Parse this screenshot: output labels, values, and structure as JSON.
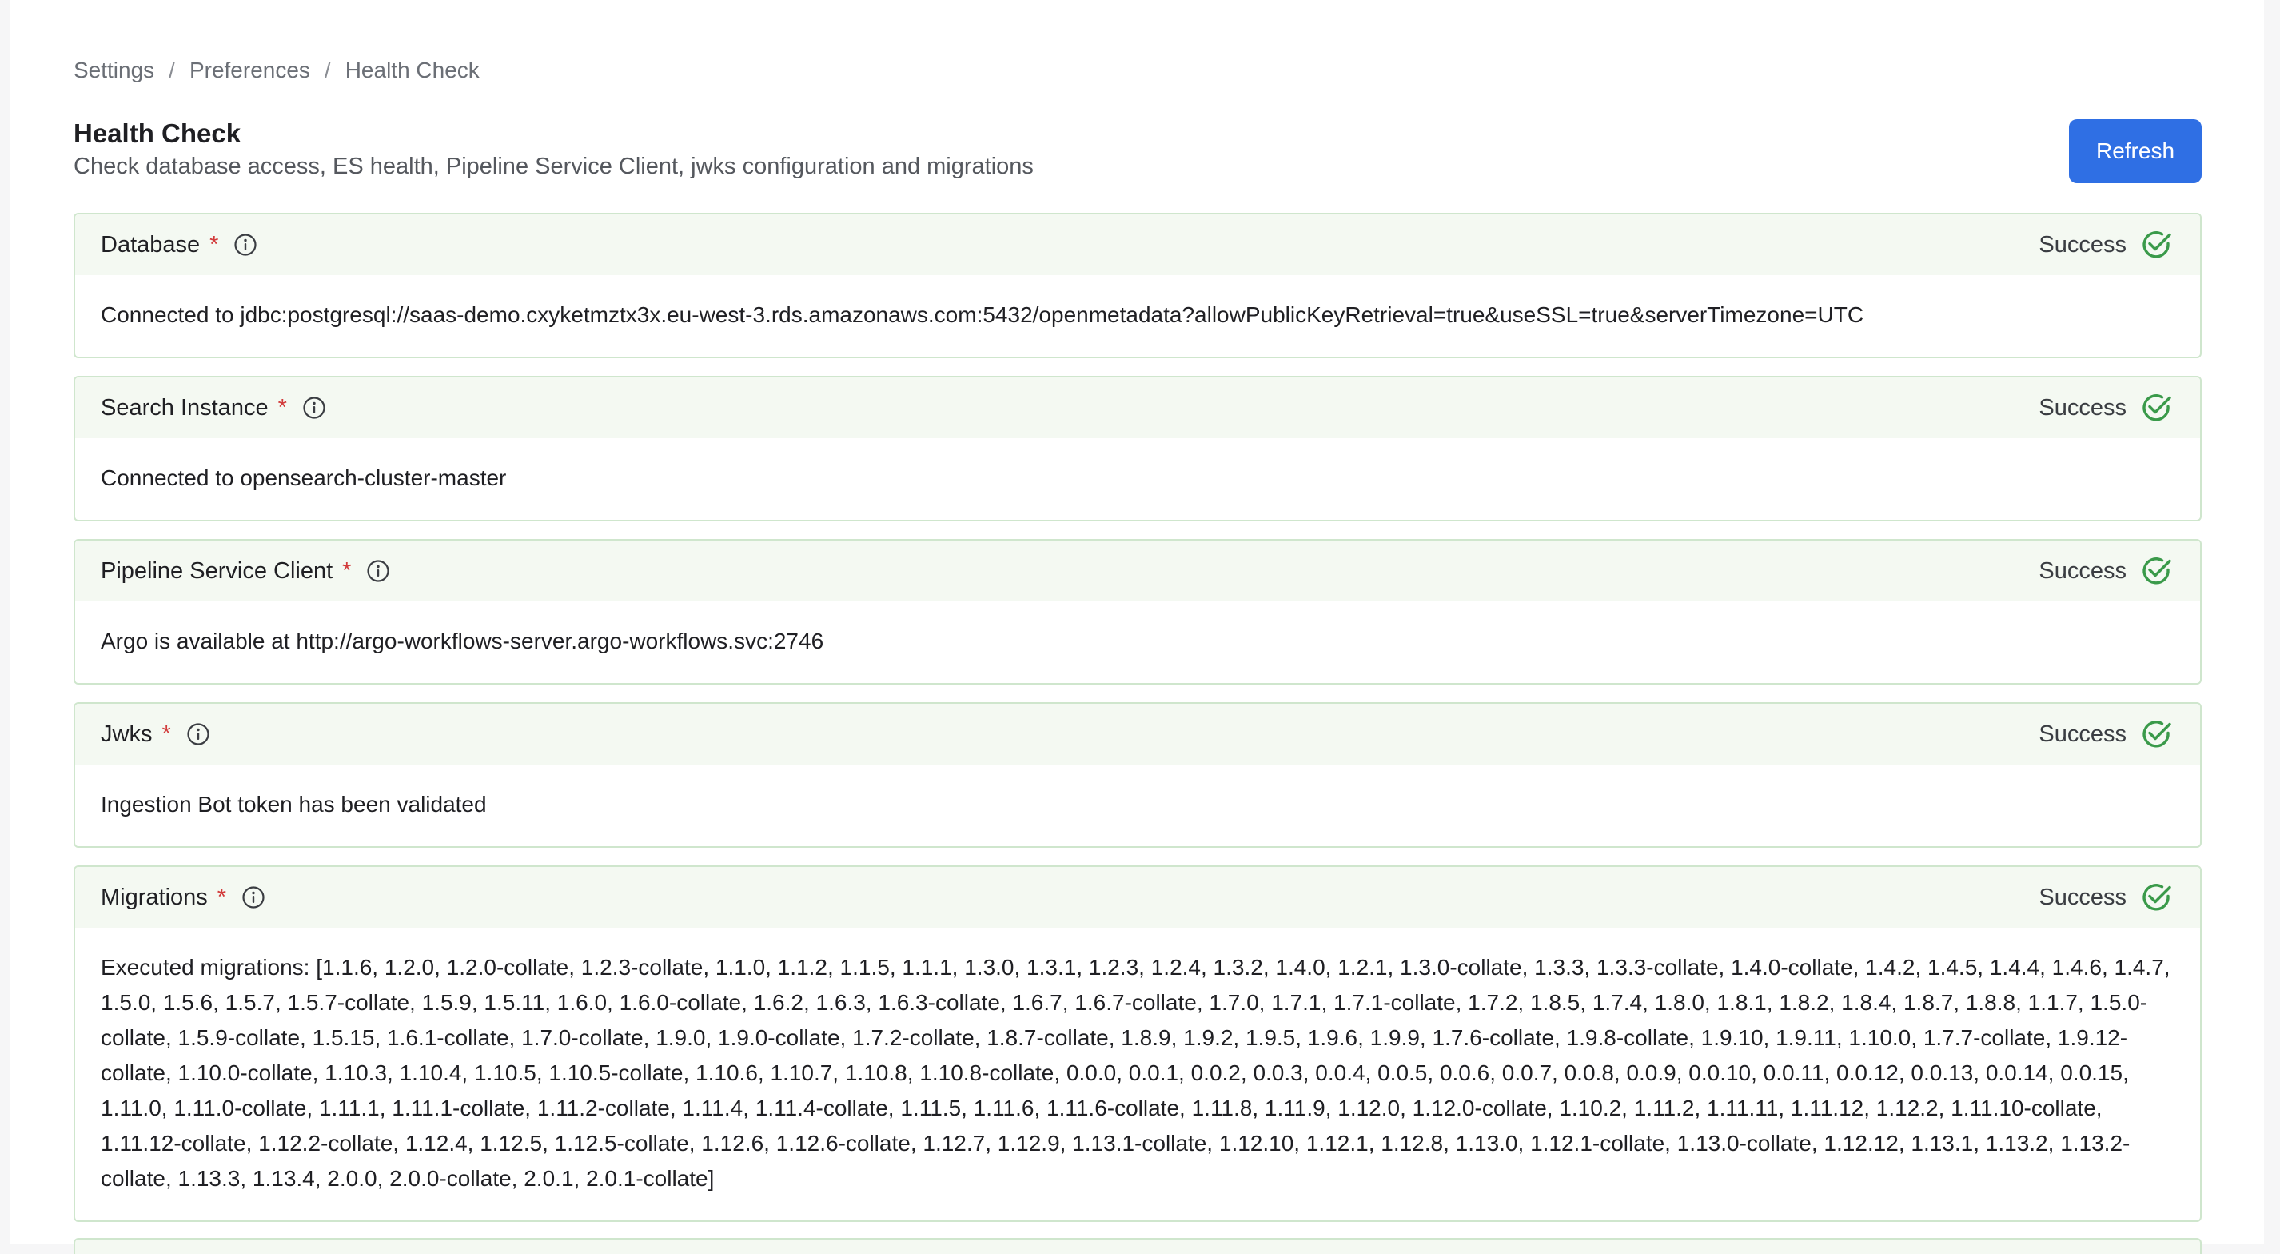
{
  "breadcrumb": {
    "items": [
      "Settings",
      "Preferences",
      "Health Check"
    ],
    "separator": "/"
  },
  "header": {
    "title": "Health Check",
    "subtitle": "Check database access, ES health, Pipeline Service Client, jwks configuration and migrations",
    "refresh_label": "Refresh"
  },
  "colors": {
    "accent": "#2f6fe4",
    "success": "#3a9a4a",
    "required": "#d23b3b",
    "card_border": "#cfe6cd",
    "card_header_bg": "#f4f9f2"
  },
  "checks": [
    {
      "name": "Database",
      "required_mark": "*",
      "status": "Success",
      "message": "Connected to jdbc:postgresql://saas-demo.cxyketmztx3x.eu-west-3.rds.amazonaws.com:5432/openmetadata?allowPublicKeyRetrieval=true&useSSL=true&serverTimezone=UTC"
    },
    {
      "name": "Search Instance",
      "required_mark": "*",
      "status": "Success",
      "message": "Connected to opensearch-cluster-master"
    },
    {
      "name": "Pipeline Service Client",
      "required_mark": "*",
      "status": "Success",
      "message": "Argo is available at http://argo-workflows-server.argo-workflows.svc:2746"
    },
    {
      "name": "Jwks",
      "required_mark": "*",
      "status": "Success",
      "message": "Ingestion Bot token has been validated"
    },
    {
      "name": "Migrations",
      "required_mark": "*",
      "status": "Success",
      "message": "Executed migrations: [1.1.6, 1.2.0, 1.2.0-collate, 1.2.3-collate, 1.1.0, 1.1.2, 1.1.5, 1.1.1, 1.3.0, 1.3.1, 1.2.3, 1.2.4, 1.3.2, 1.4.0, 1.2.1, 1.3.0-collate, 1.3.3, 1.3.3-collate, 1.4.0-collate, 1.4.2, 1.4.5, 1.4.4, 1.4.6, 1.4.7, 1.5.0, 1.5.6, 1.5.7, 1.5.7-collate, 1.5.9, 1.5.11, 1.6.0, 1.6.0-collate, 1.6.2, 1.6.3, 1.6.3-collate, 1.6.7, 1.6.7-collate, 1.7.0, 1.7.1, 1.7.1-collate, 1.7.2, 1.8.5, 1.7.4, 1.8.0, 1.8.1, 1.8.2, 1.8.4, 1.8.7, 1.8.8, 1.1.7, 1.5.0-collate, 1.5.9-collate, 1.5.15, 1.6.1-collate, 1.7.0-collate, 1.9.0, 1.9.0-collate, 1.7.2-collate, 1.8.7-collate, 1.8.9, 1.9.2, 1.9.5, 1.9.6, 1.9.9, 1.7.6-collate, 1.9.8-collate, 1.9.10, 1.9.11, 1.10.0, 1.7.7-collate, 1.9.12-collate, 1.10.0-collate, 1.10.3, 1.10.4, 1.10.5, 1.10.5-collate, 1.10.6, 1.10.7, 1.10.8, 1.10.8-collate, 0.0.0, 0.0.1, 0.0.2, 0.0.3, 0.0.4, 0.0.5, 0.0.6, 0.0.7, 0.0.8, 0.0.9, 0.0.10, 0.0.11, 0.0.12, 0.0.13, 0.0.14, 0.0.15, 1.11.0, 1.11.0-collate, 1.11.1, 1.11.1-collate, 1.11.2-collate, 1.11.4, 1.11.4-collate, 1.11.5, 1.11.6, 1.11.6-collate, 1.11.8, 1.11.9, 1.12.0, 1.12.0-collate, 1.10.2, 1.11.2, 1.11.11, 1.11.12, 1.12.2, 1.11.10-collate, 1.11.12-collate, 1.12.2-collate, 1.12.4, 1.12.5, 1.12.5-collate, 1.12.6, 1.12.6-collate, 1.12.7, 1.12.9, 1.13.1-collate, 1.12.10, 1.12.1, 1.12.8, 1.13.0, 1.12.1-collate, 1.13.0-collate, 1.12.12, 1.13.1, 1.13.2, 1.13.2-collate, 1.13.3, 1.13.4, 2.0.0, 2.0.0-collate, 2.0.1, 2.0.1-collate]"
    }
  ],
  "icons": {
    "info": "info-icon",
    "status": "check-circle-icon"
  }
}
